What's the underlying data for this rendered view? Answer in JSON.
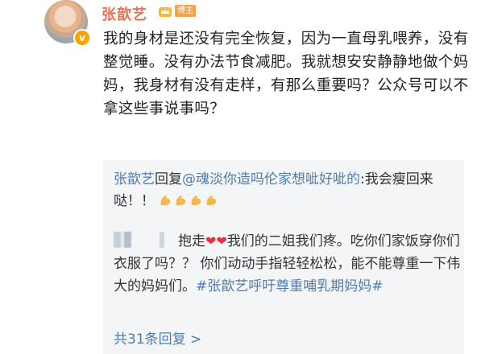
{
  "author": {
    "name": "张歆艺",
    "verified_mark": "v",
    "host_badge": "博主"
  },
  "post": {
    "text": "我的身材是还没有完全恢复，因为一直母乳喂养，没有整觉睡。没有办法节食减肥。我就想安安静静地做个妈妈，我身材有没有走样，有那么重要吗？公众号可以不拿这些事说事吗？"
  },
  "replies": [
    {
      "author": "张歆艺",
      "action": "回复",
      "target": "@魂淡你造吗伦家想呲好呲的",
      "text": ":我会瘦回来哒！！",
      "emoji_count": 4,
      "emoji_icon": "flexed-biceps-icon"
    },
    {
      "prefix": "抱走",
      "hearts": "❤❤",
      "text_a": "我们的二姐我们疼。吃你们家饭穿你们衣服了吗？？ 你们动动手指轻轻松松，能不能尊重一下伟大的妈妈们。",
      "hashtag": "#张歆艺呼吁尊重哺乳期妈妈#"
    }
  ],
  "more_replies_label": "共31条回复 >",
  "colors": {
    "username": "#eb7350",
    "link": "#507daf",
    "reply_bg": "#f4f5f7",
    "heart": "#e8313b"
  }
}
